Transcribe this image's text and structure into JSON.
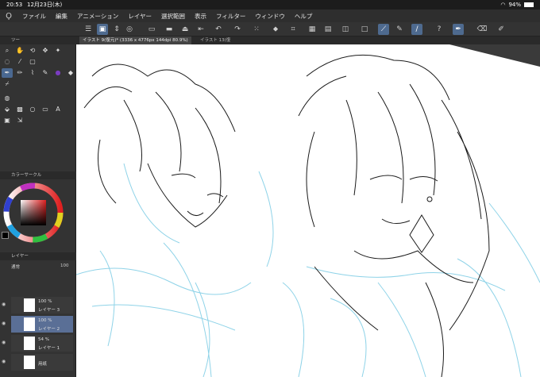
{
  "status": {
    "time": "20:53",
    "date": "12月23日(木)",
    "battery": "94%"
  },
  "menu": [
    "ファイル",
    "編集",
    "アニメーション",
    "レイヤー",
    "選択範囲",
    "表示",
    "フィルター",
    "ウィンドウ",
    "ヘルプ"
  ],
  "tabs": {
    "active": "イラスト 9(復元)* (3336 x 4776px 144dpi 80.9%)",
    "other": "イラスト 13(復"
  },
  "panels": {
    "tool_label": "ツー",
    "color_header": "カラーサークル",
    "layer_header": "レイヤー",
    "blend_mode": "通常",
    "layer_opacity": "100"
  },
  "layers": [
    {
      "pct": "100 %",
      "mode": "通",
      "name": "レイヤー 3",
      "selected": false
    },
    {
      "pct": "100 %",
      "mode": "通",
      "name": "レイヤー 2",
      "selected": true
    },
    {
      "pct": "54 %",
      "mode": "通常",
      "name": "レイヤー 1",
      "selected": false
    },
    {
      "pct": "",
      "mode": "",
      "name": "用紙",
      "selected": false
    }
  ],
  "colors": {
    "accent": "#4e6a8f",
    "panel": "#333333",
    "sketch": "#8fd3e8",
    "line": "#1a1a1a"
  }
}
